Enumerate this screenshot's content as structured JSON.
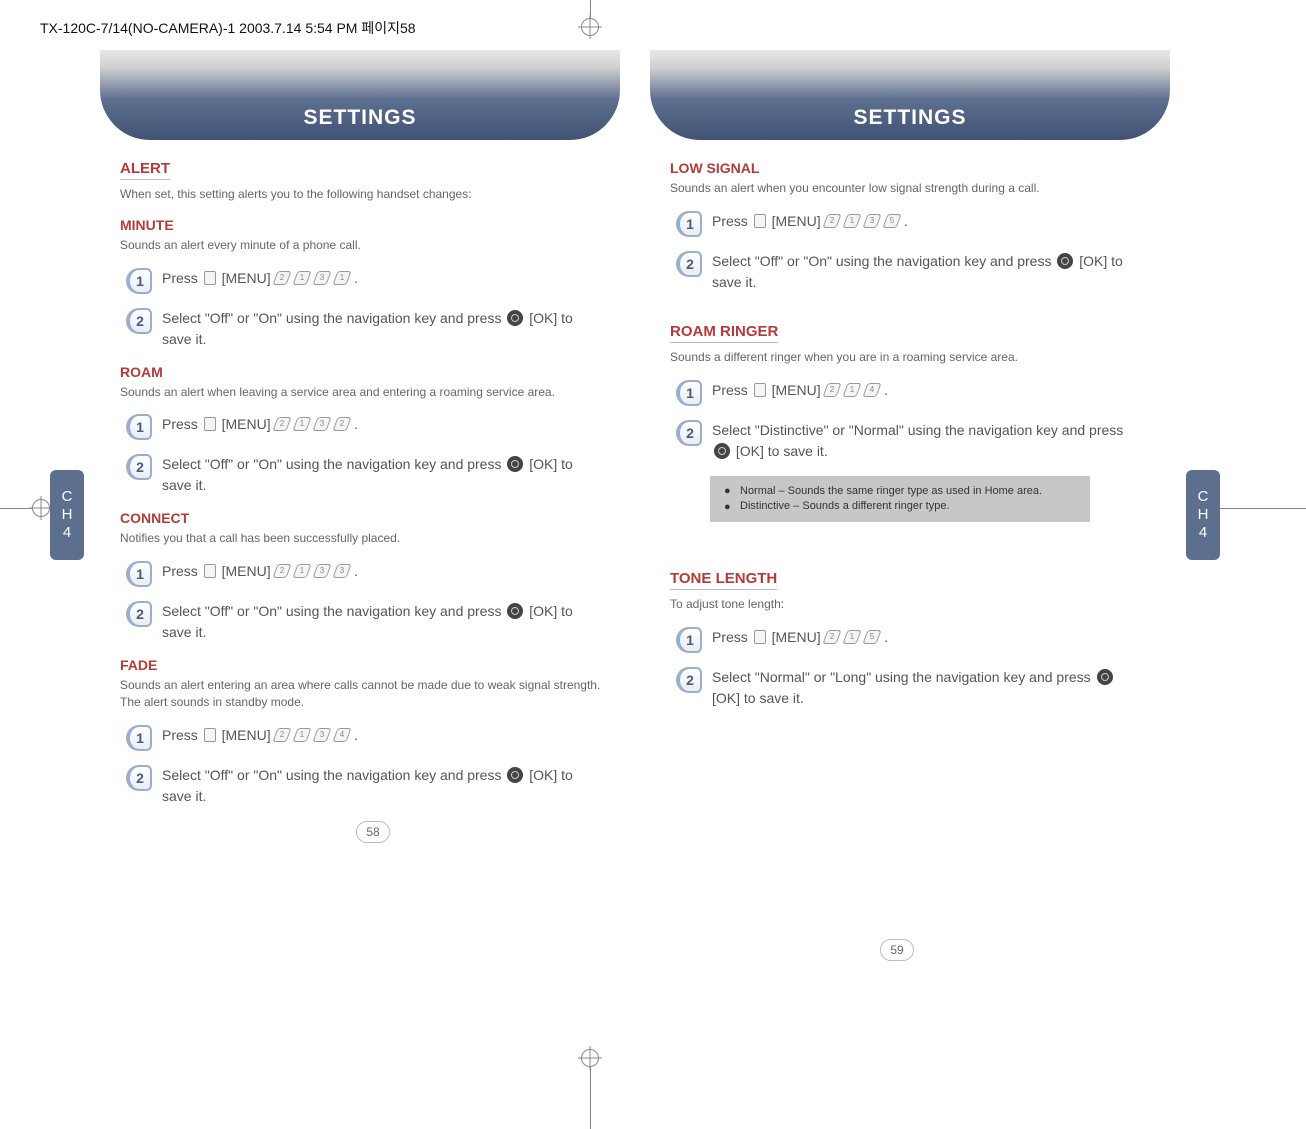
{
  "doc_header": "TX-120C-7/14(NO-CAMERA)-1  2003.7.14 5:54 PM  페이지58",
  "title": "SETTINGS",
  "side_tab": {
    "line1": "C",
    "line2": "H",
    "line3": "4"
  },
  "page_numbers": {
    "left": "58",
    "right": "59"
  },
  "left": {
    "alert_heading": "ALERT",
    "alert_intro": "When set, this setting alerts you to the following handset changes:",
    "minute_heading": "MINUTE",
    "minute_intro": "Sounds an alert every minute of a phone call.",
    "minute_step1": "Press        [MENU]                          .",
    "minute_step2": "Select \"Off\" or \"On\" using the navigation key and press        [OK] to save it.",
    "roam_heading": "ROAM",
    "roam_intro": "Sounds an alert when leaving a service area and entering a roaming service area.",
    "roam_step1": "Press        [MENU]                          .",
    "roam_step2": "Select \"Off\" or \"On\" using the navigation key and press        [OK] to save it.",
    "connect_heading": "CONNECT",
    "connect_intro": "Notifies you that a call has been successfully placed.",
    "connect_step1": "Press        [MENU]                          .",
    "connect_step2": "Select \"Off\" or \"On\" using the navigation key and press        [OK] to save it.",
    "fade_heading": "FADE",
    "fade_intro": "Sounds an alert entering an area where calls cannot be made due to weak signal strength. The alert sounds in standby mode.",
    "fade_step1": "Press        [MENU]                          .",
    "fade_step2": "Select \"Off\" or \"On\" using the navigation key and press        [OK] to save it."
  },
  "right": {
    "lowsig_heading": "LOW SIGNAL",
    "lowsig_intro": "Sounds an alert when you encounter low signal strength during a call.",
    "lowsig_step1": "Press        [MENU]                          .",
    "lowsig_step2": "Select \"Off\" or \"On\" using the navigation key and press        [OK] to save it.",
    "roamringer_heading": "ROAM RINGER",
    "roamringer_intro": "Sounds a different ringer when you are in a roaming service area.",
    "roamringer_step1": "Press        [MENU]                    .",
    "roamringer_step2": "Select \"Distinctive\" or \"Normal\" using the navigation key and press        [OK] to save it.",
    "roamringer_note1": "Normal – Sounds the same ringer type as used in Home area.",
    "roamringer_note2": "Distinctive – Sounds a different ringer type.",
    "tonelen_heading": "TONE LENGTH",
    "tonelen_intro": "To adjust tone length:",
    "tonelen_step1": "Press        [MENU]                    .",
    "tonelen_step2": "Select \"Normal\" or \"Long\" using the navigation key and press        [OK] to save it."
  },
  "keys": {
    "minute": [
      "2",
      "1",
      "3",
      "1"
    ],
    "roam": [
      "2",
      "1",
      "3",
      "2"
    ],
    "connect": [
      "2",
      "1",
      "3",
      "3"
    ],
    "fade": [
      "2",
      "1",
      "3",
      "4"
    ],
    "lowsig": [
      "2",
      "1",
      "3",
      "5"
    ],
    "roamringer": [
      "2",
      "1",
      "4"
    ],
    "tonelen": [
      "2",
      "1",
      "5"
    ]
  }
}
